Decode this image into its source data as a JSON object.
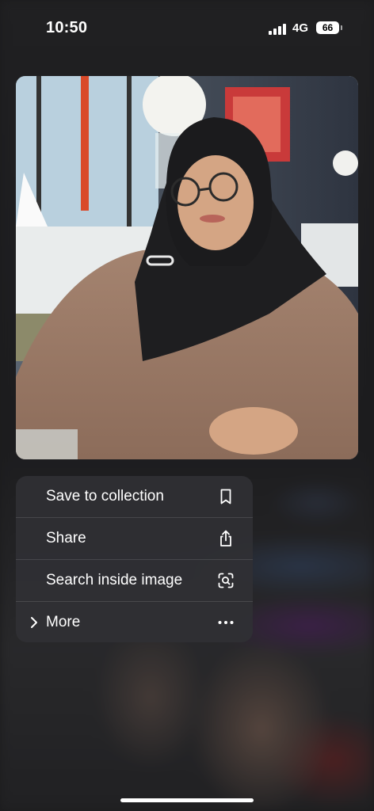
{
  "status_bar": {
    "time": "10:50",
    "network": "4G",
    "battery": "66"
  },
  "photo": {
    "subject": "portrait-photo"
  },
  "menu": {
    "items": [
      {
        "label": "Save to collection",
        "icon": "bookmark-icon"
      },
      {
        "label": "Share",
        "icon": "share-icon"
      },
      {
        "label": "Search inside image",
        "icon": "lens-search-icon"
      },
      {
        "label": "More",
        "icon": "more-dots-icon"
      }
    ]
  }
}
